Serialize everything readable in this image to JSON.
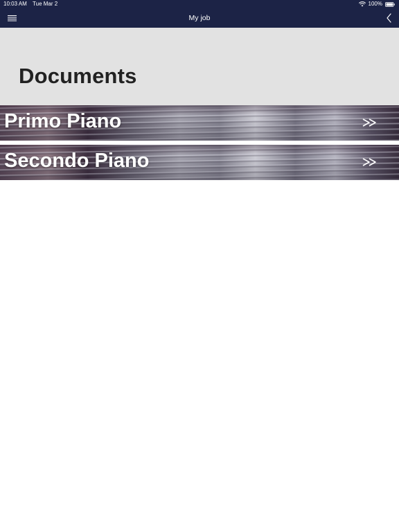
{
  "status_bar": {
    "time": "10:03 AM",
    "date": "Tue Mar 2",
    "battery": "100%"
  },
  "nav": {
    "title": "My job",
    "menu_icon": "hamburger-menu-icon",
    "back_icon": "chevron-left-icon"
  },
  "header": {
    "title": "Documents"
  },
  "banners": [
    {
      "label": "Primo Piano",
      "icon": "double-chevron-right-icon"
    },
    {
      "label": "Secondo Piano",
      "icon": "double-chevron-right-icon"
    }
  ],
  "colors": {
    "nav_background": "#1c2346",
    "header_background": "#e2e2e2",
    "title_text": "#222222"
  }
}
